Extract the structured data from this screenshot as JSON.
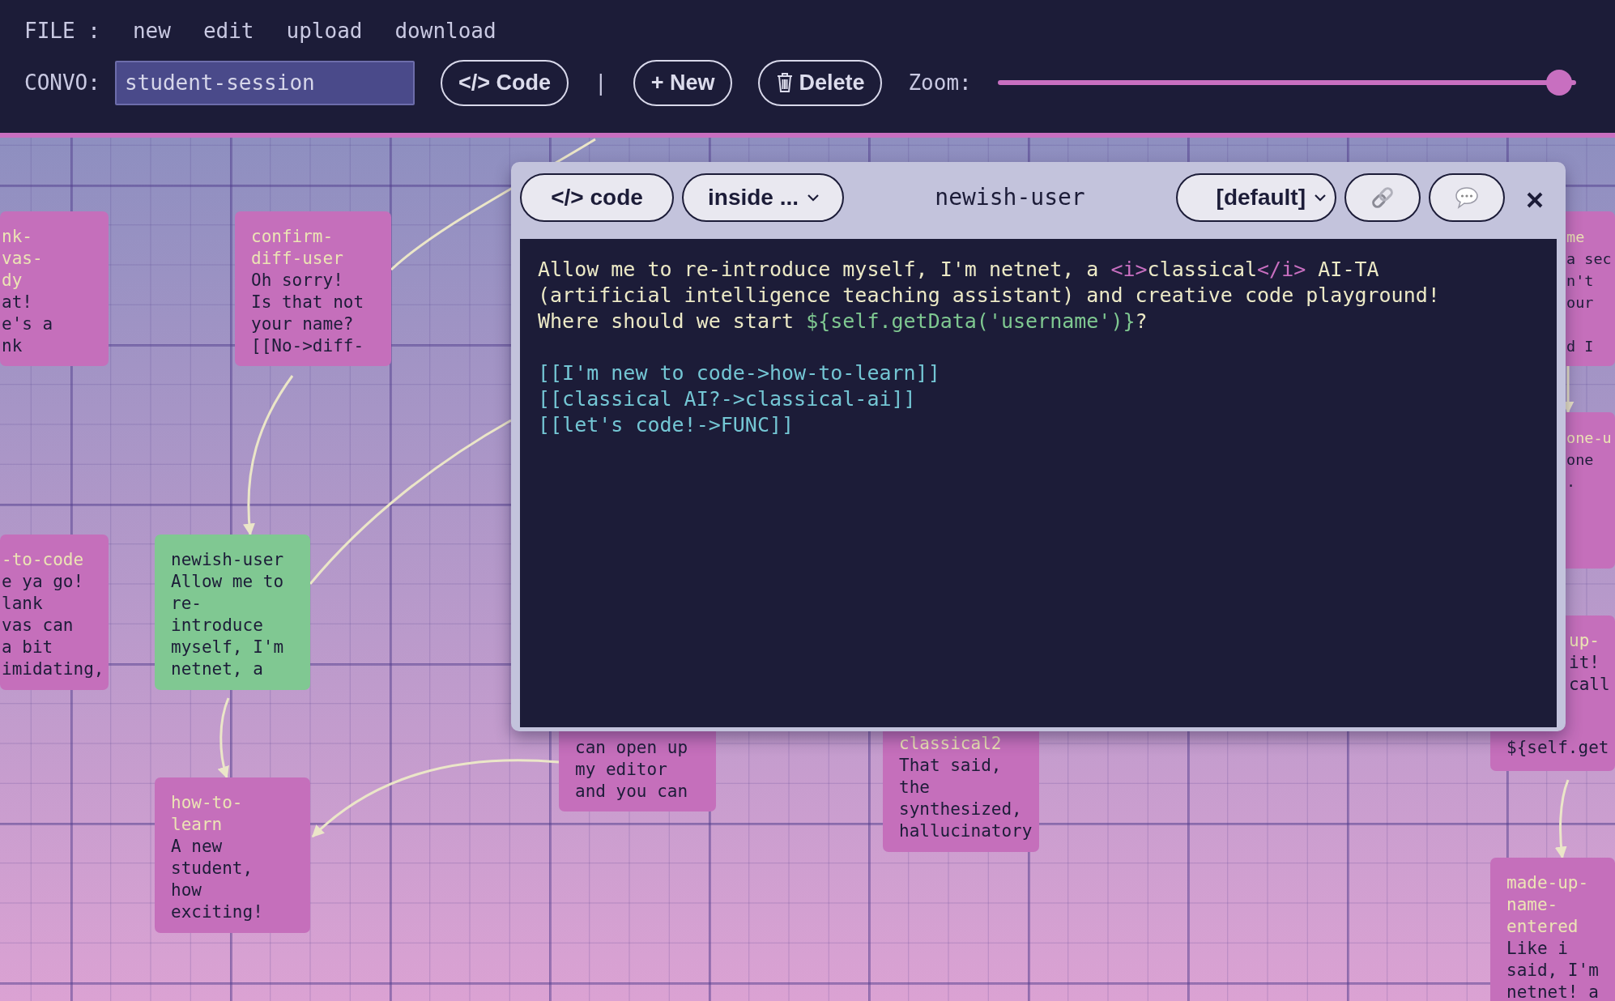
{
  "menu": {
    "label": "FILE :",
    "items": [
      "new",
      "edit",
      "upload",
      "download"
    ]
  },
  "toolbar": {
    "convo_label": "CONVO:",
    "convo_value": "student-session",
    "items": [
      {
        "kind": "button",
        "label": "</> Code"
      },
      {
        "kind": "separator",
        "label": "|"
      },
      {
        "kind": "button",
        "label": "+ New"
      },
      {
        "kind": "delete",
        "label": "Delete"
      }
    ],
    "zoom_label": "Zoom:",
    "zoom": {
      "level": 0.97
    }
  },
  "nodes": [
    {
      "title": "nk-\nvas-\ndy",
      "text": "at!\ne's a\nnk",
      "selected": false
    },
    {
      "title": "confirm-\ndiff-user",
      "text": "Oh sorry!\nIs that not\nyour name?\n[[No->diff-",
      "selected": false
    },
    {
      "title": "-to-code",
      "text": "e ya go!\nlank\nvas can\na bit\nimidating,",
      "selected": false
    },
    {
      "title": "newish-user",
      "text": "Allow me to\nre-\nintroduce\nmyself, I'm\nnetnet, a",
      "selected": true
    },
    {
      "title": "how-to-\nlearn",
      "text": "A new\nstudent,\nhow\nexciting!",
      "selected": false
    },
    {
      "text": "can open up\nmy editor\nand you can",
      "selected": false
    },
    {
      "title": "classical2",
      "text": "That said,\nthe\nsynthesized,\nhallucinatory",
      "selected": false
    },
    {
      "title": "me",
      "text": "a sec\nn't\nour\n\nd I",
      "selected": false
    },
    {
      "title": "one-u",
      "text": "one\n.",
      "selected": false
    },
    {
      "title": "up-",
      "text": "it!\ncall",
      "text_more": "${self.get",
      "selected": false
    },
    {
      "title": "made-up-\nname-\nentered",
      "text": "Like i\nsaid, I'm\nnetnet! a",
      "selected": false
    }
  ],
  "editor": {
    "code_button": "</> code",
    "context": "inside ...",
    "title": "newish-user",
    "mode": "[default]",
    "paragraphs": [
      [
        [
          {
            "kind": "text",
            "text": "Allow me to re-introduce myself, I'm netnet, a "
          },
          {
            "kind": "tag",
            "text": "<i>"
          },
          {
            "kind": "text",
            "text": "classical"
          },
          {
            "kind": "tag",
            "text": "</i>"
          },
          {
            "kind": "text",
            "text": " AI-TA"
          }
        ],
        [
          {
            "kind": "text",
            "text": "(artificial intelligence teaching assistant) and creative code playground!"
          }
        ],
        [
          {
            "kind": "text",
            "text": "Where should we start "
          },
          {
            "kind": "expr",
            "text": "${self.getData('username')}"
          },
          {
            "kind": "text",
            "text": "?"
          }
        ]
      ],
      [
        [
          {
            "kind": "link",
            "text": "[[I'm new to code->how-to-learn]]"
          }
        ],
        [
          {
            "kind": "link",
            "text": "[[classical AI?->classical-ai]]"
          }
        ],
        [
          {
            "kind": "link",
            "text": "[[let's code!->FUNC]]"
          }
        ]
      ]
    ]
  }
}
